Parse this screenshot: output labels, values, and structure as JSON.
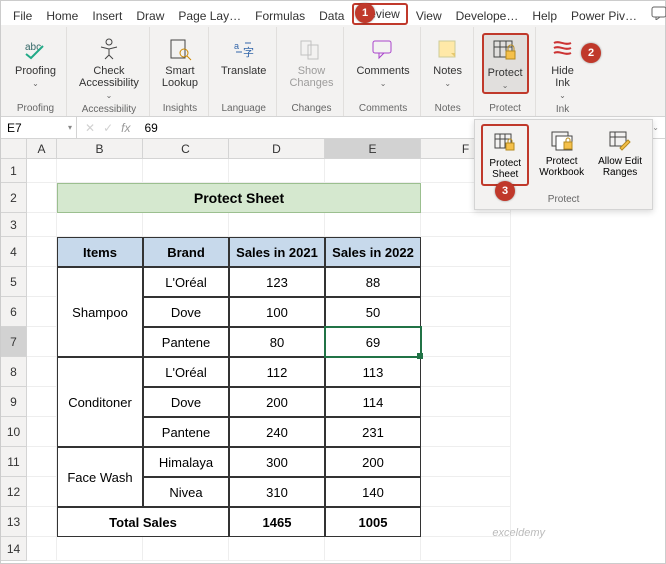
{
  "tabs": [
    "File",
    "Home",
    "Insert",
    "Draw",
    "Page Lay…",
    "Formulas",
    "Data",
    "Review",
    "View",
    "Develope…",
    "Help",
    "Power Piv…"
  ],
  "active_tab_index": 7,
  "ribbon": {
    "proofing": {
      "label": "Proofing",
      "items": {
        "proofing": "Proofing"
      }
    },
    "accessibility": {
      "label": "Accessibility",
      "items": {
        "check": "Check\nAccessibility"
      }
    },
    "insights": {
      "label": "Insights",
      "items": {
        "smart": "Smart\nLookup"
      }
    },
    "language": {
      "label": "Language",
      "items": {
        "translate": "Translate"
      }
    },
    "changes": {
      "label": "Changes",
      "items": {
        "show": "Show\nChanges"
      }
    },
    "comments": {
      "label": "Comments",
      "items": {
        "comments": "Comments"
      }
    },
    "notes": {
      "label": "Notes",
      "items": {
        "notes": "Notes"
      }
    },
    "protect": {
      "label": "Protect",
      "items": {
        "protect": "Protect"
      }
    },
    "ink": {
      "label": "Ink",
      "items": {
        "hide": "Hide\nInk"
      }
    }
  },
  "protect_menu": {
    "label": "Protect",
    "items": {
      "sheet": "Protect\nSheet",
      "workbook": "Protect\nWorkbook",
      "ranges": "Allow Edit\nRanges"
    }
  },
  "badges": {
    "b1": "1",
    "b2": "2",
    "b3": "3"
  },
  "formula_bar": {
    "name": "E7",
    "value": "69"
  },
  "columns": [
    "A",
    "B",
    "C",
    "D",
    "E",
    "F"
  ],
  "rows": [
    "1",
    "2",
    "3",
    "4",
    "5",
    "6",
    "7",
    "8",
    "9",
    "10",
    "11",
    "12",
    "13",
    "14"
  ],
  "active_row": "7",
  "active_col": "E",
  "title": "Protect Sheet",
  "table": {
    "headers": [
      "Items",
      "Brand",
      "Sales in 2021",
      "Sales in 2022"
    ],
    "groups": [
      {
        "item": "Shampoo",
        "rows": [
          {
            "brand": "L'Oréal",
            "s21": "123",
            "s22": "88"
          },
          {
            "brand": "Dove",
            "s21": "100",
            "s22": "50"
          },
          {
            "brand": "Pantene",
            "s21": "80",
            "s22": "69"
          }
        ]
      },
      {
        "item": "Conditoner",
        "rows": [
          {
            "brand": "L'Oréal",
            "s21": "112",
            "s22": "113"
          },
          {
            "brand": "Dove",
            "s21": "200",
            "s22": "114"
          },
          {
            "brand": "Pantene",
            "s21": "240",
            "s22": "231"
          }
        ]
      },
      {
        "item": "Face Wash",
        "rows": [
          {
            "brand": "Himalaya",
            "s21": "300",
            "s22": "200"
          },
          {
            "brand": "Nivea",
            "s21": "310",
            "s22": "140"
          }
        ]
      }
    ],
    "total": {
      "label": "Total Sales",
      "s21": "1465",
      "s22": "1005"
    }
  },
  "watermark": "exceldemy"
}
